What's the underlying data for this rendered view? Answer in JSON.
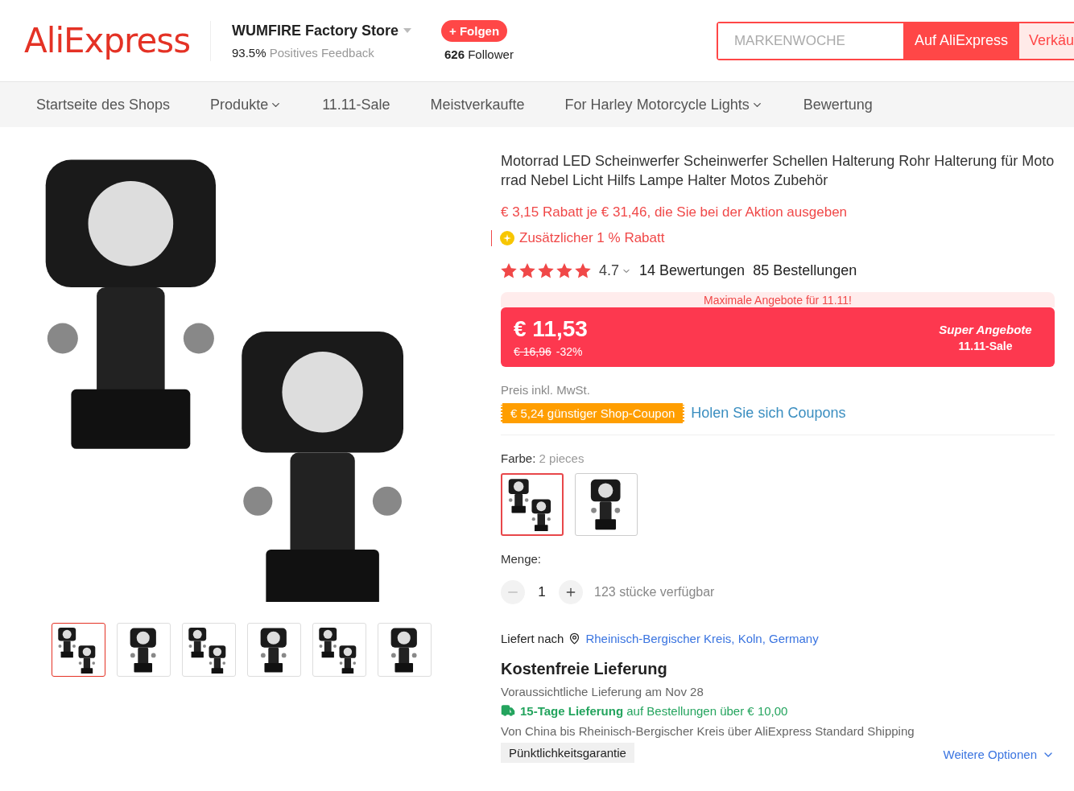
{
  "header": {
    "logo": "AliExpress",
    "store": {
      "name": "WUMFIRE Factory Store",
      "feedback_value": "93.5%",
      "feedback_label": "Positives Feedback",
      "follow_button": "+ Folgen",
      "followers_count": "626",
      "followers_label": "Follower"
    },
    "search": {
      "placeholder": "MARKENWOCHE",
      "buttons": [
        {
          "label": "Auf AliExpress",
          "selected": true
        },
        {
          "label": "Verkäu",
          "selected": false
        }
      ]
    }
  },
  "nav": {
    "items": [
      {
        "label": "Startseite des Shops",
        "has_dropdown": false
      },
      {
        "label": "Produkte",
        "has_dropdown": true
      },
      {
        "label": "11.11-Sale",
        "has_dropdown": false
      },
      {
        "label": "Meistverkaufte",
        "has_dropdown": false
      },
      {
        "label": "For Harley Motorcycle Lights",
        "has_dropdown": true
      },
      {
        "label": "Bewertung",
        "has_dropdown": false
      }
    ]
  },
  "gallery": {
    "thumbnails": [
      {
        "selected": true
      },
      {
        "selected": false
      },
      {
        "selected": false
      },
      {
        "selected": false
      },
      {
        "selected": false
      },
      {
        "selected": false
      }
    ]
  },
  "product": {
    "title": "Motorrad LED Scheinwerfer Scheinwerfer Schellen Halterung Rohr Halterung für Motorrad Nebel Licht Hilfs Lampe Halter Motos Zubehör",
    "promo": "€ 3,15 Rabatt je € 31,46, die Sie bei der Aktion ausgeben",
    "extra_discount": "Zusätzlicher 1 % Rabatt",
    "stars": 5,
    "rating": "4.7",
    "reviews": "14 Bewertungen",
    "orders": "85 Bestellungen",
    "price_banner": {
      "top": "Maximale Angebote für 11.11!",
      "price": "€ 11,53",
      "old_price": "€ 16,96",
      "discount": "-32%",
      "badge_title": "Super Angebote",
      "badge_sub": "11.11-Sale"
    },
    "tax_note": "Preis inkl. MwSt.",
    "coupon": "€ 5,24 günstiger Shop-Coupon",
    "coupon_link": "Holen Sie sich Coupons",
    "variant": {
      "label": "Farbe:",
      "value": "2 pieces",
      "options": [
        {
          "selected": true
        },
        {
          "selected": false
        }
      ]
    },
    "quantity": {
      "label": "Menge:",
      "value": "1",
      "minus_disabled": true,
      "stock": "123 stücke verfügbar"
    }
  },
  "shipping": {
    "label": "Liefert nach",
    "location": "Rheinisch-Bergischer Kreis, Koln, Germany",
    "title": "Kostenfreie Lieferung",
    "estimate": "Voraussichtliche Lieferung am Nov 28",
    "fast": "**15-Tage Lieferung** auf Bestellungen über € 10,00",
    "route": "Von China bis Rheinisch-Bergischer Kreis über AliExpress Standard Shipping",
    "guarantee": "Pünktlichkeitsgarantie",
    "more_options": "Weitere Optionen"
  }
}
